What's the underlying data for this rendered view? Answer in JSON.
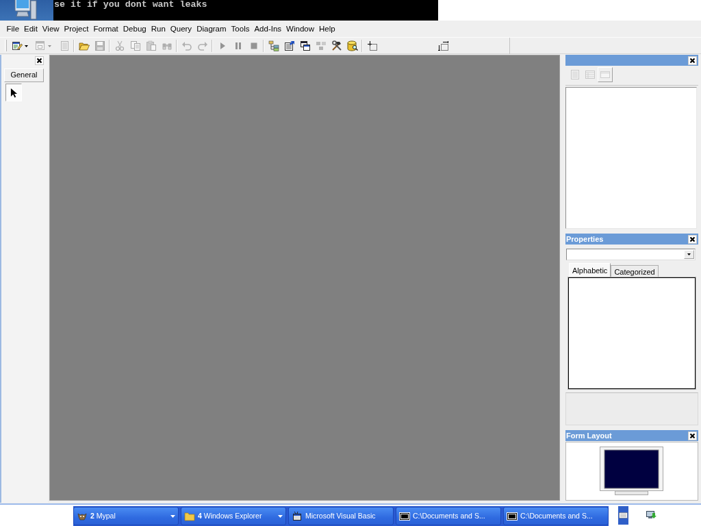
{
  "top_strip": {
    "console_text": "se it if you dont want leaks"
  },
  "menu_bar": [
    "File",
    "Edit",
    "View",
    "Project",
    "Format",
    "Debug",
    "Run",
    "Query",
    "Diagram",
    "Tools",
    "Add-Ins",
    "Window",
    "Help"
  ],
  "toolbar": [
    {
      "kind": "split",
      "disabled": false
    },
    {
      "kind": "split",
      "disabled": true
    },
    {
      "kind": "button",
      "disabled": true
    },
    {
      "kind": "separator"
    },
    {
      "kind": "button",
      "disabled": false
    },
    {
      "kind": "button",
      "disabled": true
    },
    {
      "kind": "separator"
    },
    {
      "kind": "button",
      "disabled": true
    },
    {
      "kind": "button",
      "disabled": true
    },
    {
      "kind": "button",
      "disabled": true
    },
    {
      "kind": "button",
      "disabled": true
    },
    {
      "kind": "separator"
    },
    {
      "kind": "button",
      "disabled": true
    },
    {
      "kind": "button",
      "disabled": true
    },
    {
      "kind": "separator"
    },
    {
      "kind": "button",
      "disabled": true
    },
    {
      "kind": "button",
      "disabled": true
    },
    {
      "kind": "button",
      "disabled": true
    },
    {
      "kind": "separator"
    },
    {
      "kind": "button",
      "disabled": false
    },
    {
      "kind": "button",
      "disabled": false
    },
    {
      "kind": "button",
      "disabled": false
    },
    {
      "kind": "button",
      "disabled": true
    },
    {
      "kind": "button",
      "disabled": false
    },
    {
      "kind": "button",
      "disabled": false
    },
    {
      "kind": "separator"
    },
    {
      "kind": "indicator"
    },
    {
      "kind": "indicator"
    }
  ],
  "toolbox": {
    "tab": "General",
    "tools": [
      {
        "selected": true
      }
    ]
  },
  "project_panel": {
    "buttons": [
      {
        "disabled": true,
        "pressed": false
      },
      {
        "disabled": true,
        "pressed": false
      },
      {
        "disabled": true,
        "pressed": true
      }
    ]
  },
  "properties_panel": {
    "title": "Properties",
    "tabs": [
      {
        "label": "Alphabetic",
        "selected": true
      },
      {
        "label": "Categorized",
        "selected": false
      }
    ]
  },
  "form_layout_panel": {
    "title": "Form Layout"
  },
  "taskbar": {
    "buttons": [
      {
        "kind": "group",
        "count": "2",
        "label": "Mypal",
        "selected": false
      },
      {
        "kind": "group",
        "count": "4",
        "label": "Windows Explorer",
        "selected": false
      },
      {
        "kind": "window",
        "label": "Microsoft Visual Basic",
        "selected": false
      },
      {
        "kind": "window",
        "label": "C:\\Documents and S...",
        "selected": false
      },
      {
        "kind": "window",
        "label": "C:\\Documents and S...",
        "selected": false
      }
    ]
  }
}
